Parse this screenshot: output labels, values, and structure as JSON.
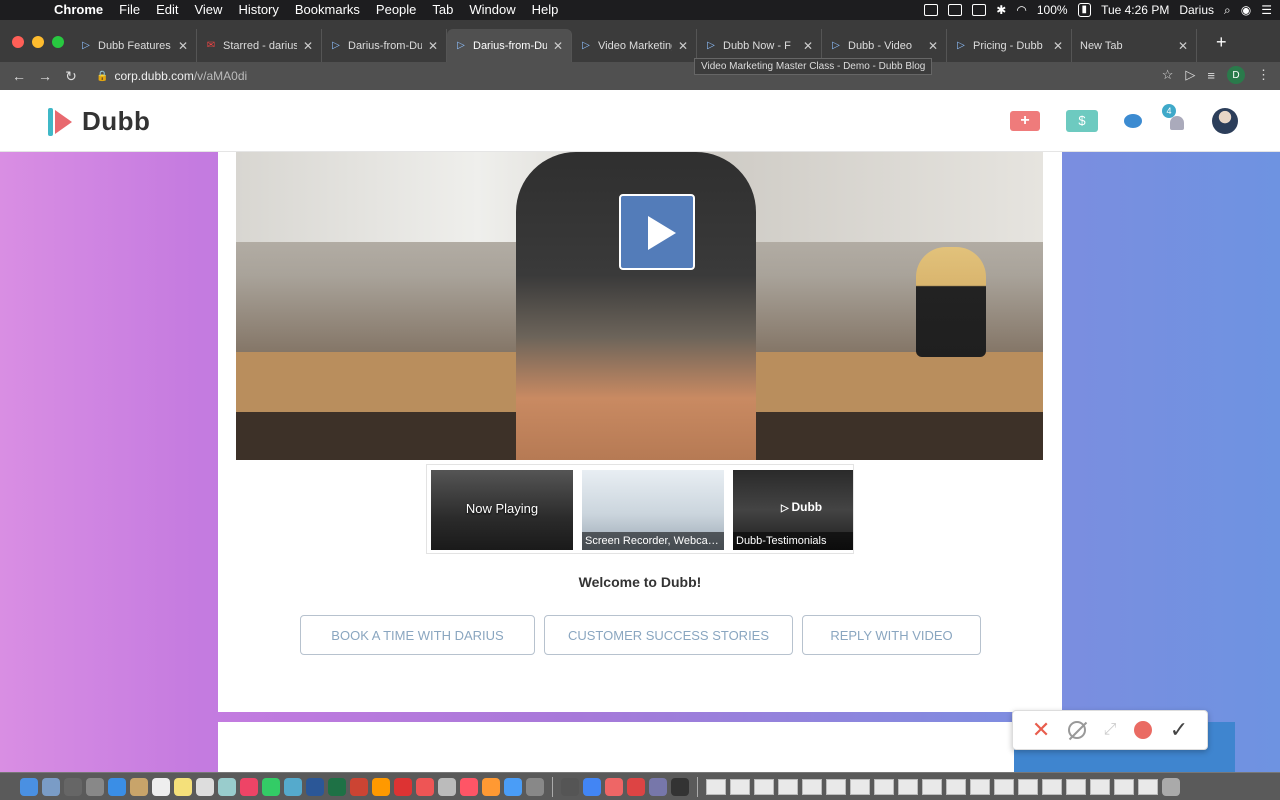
{
  "menubar": {
    "app_name": "Chrome",
    "menus": [
      "File",
      "Edit",
      "View",
      "History",
      "Bookmarks",
      "People",
      "Tab",
      "Window",
      "Help"
    ],
    "battery": "100%",
    "clock": "Tue 4:26 PM",
    "user": "Darius"
  },
  "tabs": [
    {
      "title": "Dubb Features",
      "favicon": "dubb-icon"
    },
    {
      "title": "Starred - darius",
      "favicon": "gmail-icon"
    },
    {
      "title": "Darius-from-Dubb",
      "favicon": "dubb-icon"
    },
    {
      "title": "Darius-from-Dubb",
      "favicon": "dubb-icon",
      "active": true
    },
    {
      "title": "Video Marketing",
      "favicon": "dubb-icon"
    },
    {
      "title": "Dubb Now - F",
      "favicon": "dubb-icon"
    },
    {
      "title": "Dubb - Video",
      "favicon": "dubb-icon"
    },
    {
      "title": "Pricing - Dubb",
      "favicon": "dubb-icon"
    },
    {
      "title": "New Tab",
      "favicon": ""
    }
  ],
  "toolbar": {
    "url_host": "corp.dubb.com",
    "url_path": "/v/aMA0di",
    "tooltip": "Video Marketing Master Class - Demo - Dubb Blog",
    "profile_initial": "D"
  },
  "site": {
    "logo_text": "Dubb",
    "notification_count": "4"
  },
  "playlist": [
    {
      "label": "Now Playing",
      "caption": ""
    },
    {
      "label": "",
      "caption": "Screen Recorder, Webcam..."
    },
    {
      "label": "Dubb",
      "caption": "Dubb-Testimonials"
    }
  ],
  "welcome_text": "Welcome to Dubb!",
  "cta_buttons": [
    {
      "label": "BOOK A TIME WITH DARIUS"
    },
    {
      "label": "CUSTOMER SUCCESS STORIES"
    },
    {
      "label": "REPLY WITH VIDEO"
    }
  ],
  "colors": {
    "brand_teal": "#3fb8c7",
    "brand_coral": "#e8696f",
    "play_button": "#5682c4",
    "cta_border": "#b7c2ce",
    "record_red": "#ea6b63"
  }
}
